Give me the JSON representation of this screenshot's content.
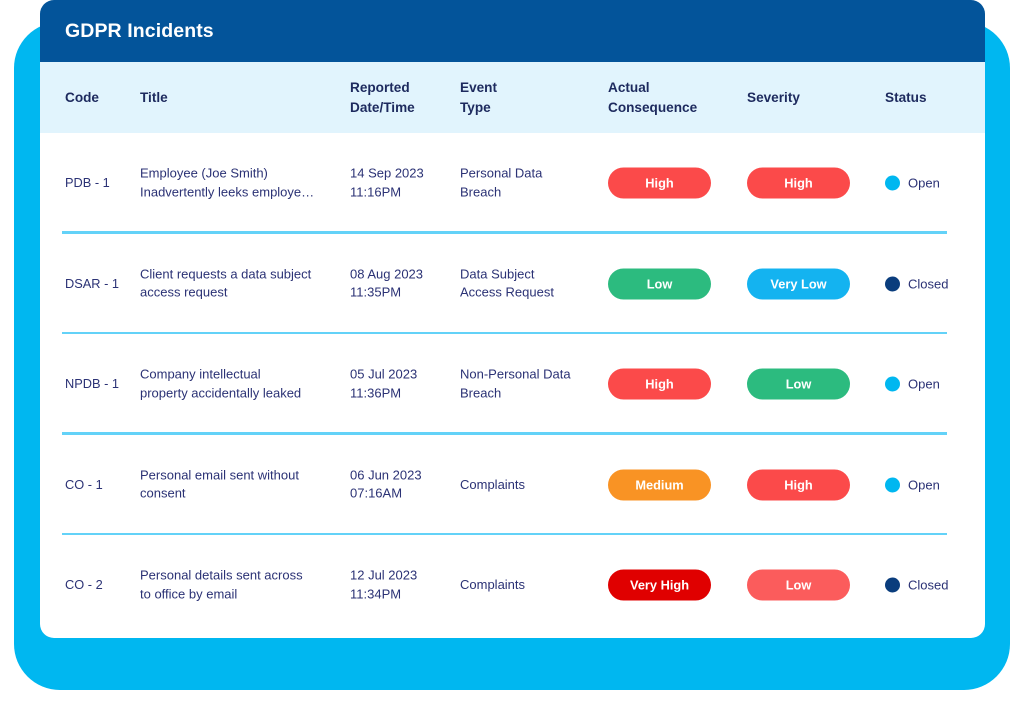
{
  "window": {
    "title": "GDPR Incidents"
  },
  "colors": {
    "backplate": "#00B7F0",
    "titlebar": "#03549A",
    "header_strip": "#E1F4FD",
    "divider": "#63D2F8",
    "text": "#2B3275",
    "header_text": "#1D2A5E",
    "very_high": "#E00000",
    "high": "#FB4A4A",
    "medium": "#F99324",
    "low_green": "#2CBB7F",
    "low_red": "#FB5C5C",
    "very_low": "#14B3F0",
    "status_open": "#00B7F0",
    "status_closed": "#0A3D7D"
  },
  "table": {
    "columns": [
      {
        "key": "code",
        "label": "Code"
      },
      {
        "key": "title",
        "label": "Title"
      },
      {
        "key": "date",
        "label": "Reported\nDate/Time"
      },
      {
        "key": "event",
        "label": "Event\nType"
      },
      {
        "key": "cons",
        "label": "Actual\nConsequence"
      },
      {
        "key": "sev",
        "label": "Severity"
      },
      {
        "key": "status",
        "label": "Status"
      }
    ],
    "column_labels": {
      "code": "Code",
      "title": "Title",
      "date_line1": "Reported",
      "date_line2": "Date/Time",
      "event_line1": "Event",
      "event_line2": "Type",
      "cons_line1": "Actual",
      "cons_line2": "Consequence",
      "severity": "Severity",
      "status": "Status"
    },
    "rows": [
      {
        "code": "PDB - 1",
        "title_line1": "Employee (Joe Smith)",
        "title_line2": "Inadvertently leeks employe…",
        "date": "14 Sep 2023",
        "time": "11:16PM",
        "event_line1": "Personal Data",
        "event_line2": "Breach",
        "consequence": {
          "label": "High",
          "color": "#FB4A4A"
        },
        "severity": {
          "label": "High",
          "color": "#FB4A4A"
        },
        "status": {
          "label": "Open",
          "color": "#00B7F0"
        }
      },
      {
        "code": "DSAR - 1",
        "title_line1": "Client requests a data subject",
        "title_line2": "access request",
        "date": "08 Aug 2023",
        "time": "11:35PM",
        "event_line1": "Data Subject",
        "event_line2": "Access Request",
        "consequence": {
          "label": "Low",
          "color": "#2CBB7F"
        },
        "severity": {
          "label": "Very Low",
          "color": "#14B3F0"
        },
        "status": {
          "label": "Closed",
          "color": "#0A3D7D"
        }
      },
      {
        "code": "NPDB - 1",
        "title_line1": "Company intellectual",
        "title_line2": "property accidentally leaked",
        "date": "05 Jul 2023",
        "time": "11:36PM",
        "event_line1": "Non-Personal Data",
        "event_line2": "Breach",
        "consequence": {
          "label": "High",
          "color": "#FB4A4A"
        },
        "severity": {
          "label": "Low",
          "color": "#2CBB7F"
        },
        "status": {
          "label": "Open",
          "color": "#00B7F0"
        }
      },
      {
        "code": "CO - 1",
        "title_line1": "Personal email sent without",
        "title_line2": "consent",
        "date": "06 Jun 2023",
        "time": "07:16AM",
        "event_line1": "Complaints",
        "event_line2": "",
        "consequence": {
          "label": "Medium",
          "color": "#F99324"
        },
        "severity": {
          "label": "High",
          "color": "#FB4A4A"
        },
        "status": {
          "label": "Open",
          "color": "#00B7F0"
        }
      },
      {
        "code": "CO - 2",
        "title_line1": "Personal details sent across",
        "title_line2": "to office by email",
        "date": "12 Jul 2023",
        "time": "11:34PM",
        "event_line1": "Complaints",
        "event_line2": "",
        "consequence": {
          "label": "Very High",
          "color": "#E00000"
        },
        "severity": {
          "label": "Low",
          "color": "#FB5C5C"
        },
        "status": {
          "label": "Closed",
          "color": "#0A3D7D"
        }
      }
    ]
  }
}
